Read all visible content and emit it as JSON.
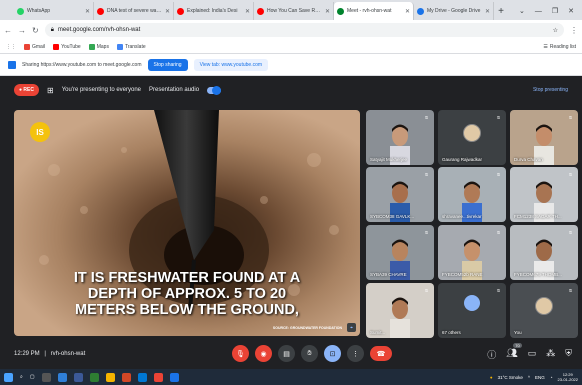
{
  "browser": {
    "tabs": [
      {
        "title": "WhatsApp",
        "favicon_color": "#25d366",
        "active": false
      },
      {
        "title": "DNA test of severe water",
        "favicon_color": "#ff0000",
        "active": false
      },
      {
        "title": "Explained: India's Desi",
        "favicon_color": "#ff0000",
        "active": false
      },
      {
        "title": "How You Can Save Rainwa",
        "favicon_color": "#ff0000",
        "active": false
      },
      {
        "title": "Meet - rvh-ohsn-wat",
        "favicon_color": "#00832d",
        "active": true
      },
      {
        "title": "My Drive - Google Drive",
        "favicon_color": "#1a73e8",
        "active": false
      }
    ],
    "new_tab_label": "+",
    "url": "meet.google.com/rvh-ohsn-wat",
    "bookmarks": [
      {
        "label": "Gmail",
        "color": "#ea4335"
      },
      {
        "label": "YouTube",
        "color": "#ff0000"
      },
      {
        "label": "Maps",
        "color": "#34a853"
      },
      {
        "label": "Translate",
        "color": "#4285f4"
      }
    ],
    "reading_list": "Reading list"
  },
  "sharing_bar": {
    "text": "Sharing https://www.youtube.com to meet.google.com",
    "stop_label": "Stop sharing",
    "view_label": "View tab: www.youtube.com"
  },
  "meet": {
    "rec_label": "REC",
    "presenting_text": "You're presenting to everyone",
    "presentation_audio": "Presentation audio",
    "stop_presenting": "Stop presenting",
    "presentation": {
      "logo_text": "IS",
      "caption_lines": [
        "IT IS FRESHWATER FOUND AT A",
        "DEPTH OF APPROX. 5 TO 20",
        "METERS BELOW THE GROUND,"
      ],
      "source": "SOURCE: GROUNDWATER FOUNDATION"
    },
    "participants": [
      {
        "name": "Satyajit Mukherjee",
        "bg": "#8a8f95",
        "skin": "#c89a7a",
        "shirt": "#d8d8e0"
      },
      {
        "name": "Gaurang Rajwadkar",
        "bg": "#3c4043",
        "avatar": true
      },
      {
        "name": "Durva Chavan",
        "bg": "#b9a38c",
        "skin": "#c48d6a",
        "shirt": "#e8e6e0"
      },
      {
        "name": "SYBCOM38 GAVLK...",
        "bg": "#9aa0a6",
        "skin": "#a86f4c",
        "shirt": "#2a5caa"
      },
      {
        "name": "shravanee...tivrekar",
        "bg": "#a8b0b6",
        "skin": "#b07a56",
        "shirt": "#3a6fd0"
      },
      {
        "name": "FCM1238 SAGAR TH...",
        "bg": "#c0c4c8",
        "skin": "#a87452",
        "shirt": "#e8e8e8"
      },
      {
        "name": "SYBA39 CHAVRE",
        "bg": "#8e959b",
        "skin": "#b8845e",
        "shirt": "#3b5ba8"
      },
      {
        "name": "FYBCOM52b RANE",
        "bg": "#a6aab0",
        "skin": "#c6916b",
        "shirt": "#d9caa6"
      },
      {
        "name": "FYBCOM679 THOMB...",
        "bg": "#b8bcc0",
        "skin": "#9e6a48",
        "shirt": "#eaeaea"
      },
      {
        "name": "Sumit...",
        "bg": "#d4cfc8",
        "skin": "#b07a56",
        "shirt": "#e6e2dc"
      },
      {
        "name": "67 others",
        "bg": "#3c4043",
        "others": true
      },
      {
        "name": "You",
        "bg": "#4a4e52",
        "avatar": true
      }
    ],
    "bottom": {
      "time": "12:29 PM",
      "separator": "|",
      "meeting_code": "rvh-ohsn-wat",
      "people_count": "70"
    }
  },
  "taskbar": {
    "weather": "31°C Smoke",
    "lang": "ENG",
    "time": "12:29",
    "date": "23-01-2022"
  }
}
